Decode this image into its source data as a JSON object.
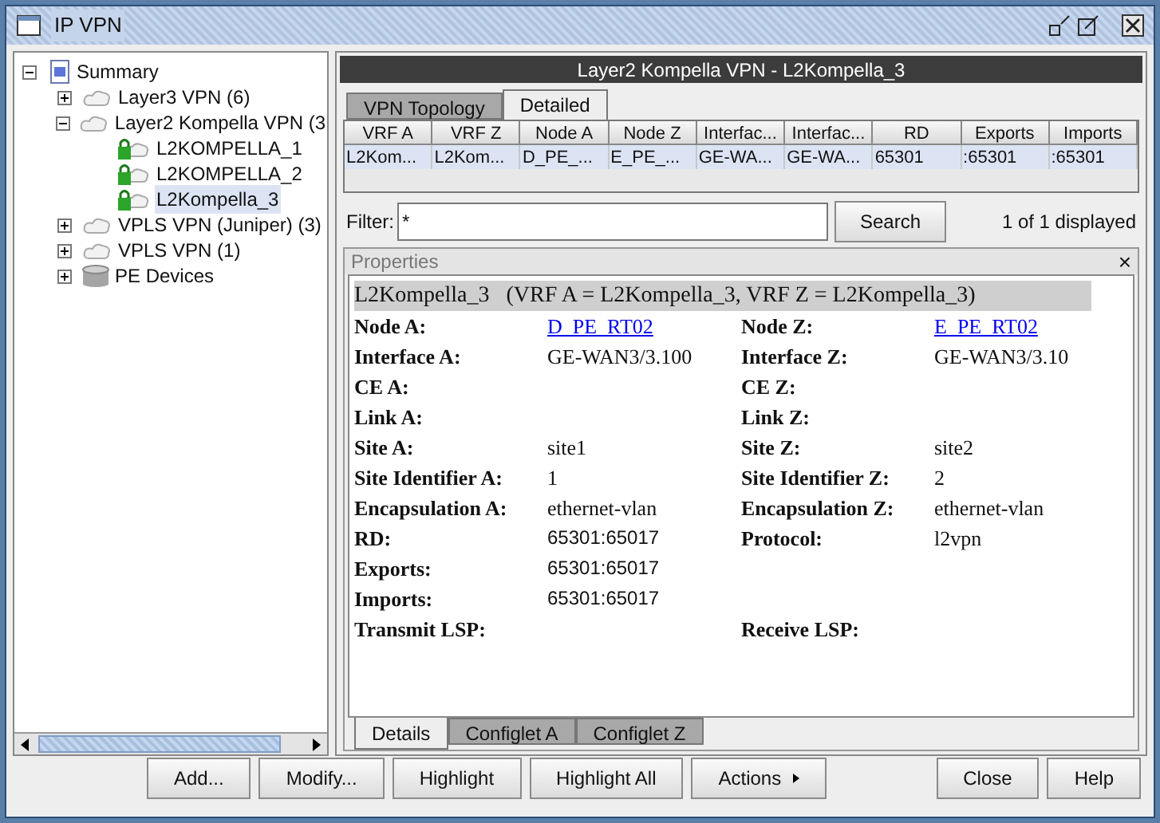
{
  "window": {
    "title": "IP VPN"
  },
  "tree": [
    {
      "label": "Summary",
      "kind": "summary",
      "expanded": true,
      "selected": false,
      "children": [
        {
          "label": "Layer3 VPN (6)",
          "kind": "vpn",
          "expanded": false,
          "selected": false
        },
        {
          "label": "Layer2 Kompella VPN (3",
          "kind": "vpn",
          "expanded": true,
          "selected": false,
          "children": [
            {
              "label": "L2KOMPELLA_1",
              "kind": "service",
              "selected": false
            },
            {
              "label": "L2KOMPELLA_2",
              "kind": "service",
              "selected": false
            },
            {
              "label": "L2Kompella_3",
              "kind": "service",
              "selected": true
            }
          ]
        },
        {
          "label": "VPLS VPN (Juniper) (3)",
          "kind": "vpn",
          "expanded": false,
          "selected": false
        },
        {
          "label": "VPLS VPN (1)",
          "kind": "vpn",
          "expanded": false,
          "selected": false
        },
        {
          "label": "PE Devices",
          "kind": "devices",
          "expanded": false,
          "selected": false
        }
      ]
    }
  ],
  "header": "Layer2 Kompella VPN - L2Kompella_3",
  "tabs": [
    {
      "label": "VPN Topology",
      "selected": false
    },
    {
      "label": "Detailed",
      "selected": true
    }
  ],
  "table": {
    "columns": [
      "VRF A",
      "VRF Z",
      "Node A",
      "Node Z",
      "Interfac...",
      "Interfac...",
      "RD",
      "Exports",
      "Imports"
    ],
    "rows": [
      {
        "selected": true,
        "cells": [
          "L2Kom...",
          "L2Kom...",
          "D_PE_...",
          "E_PE_...",
          "GE-WA...",
          "GE-WA...",
          "65301",
          ":65301",
          ":65301"
        ]
      }
    ]
  },
  "filter": {
    "label": "Filter:",
    "value": "*",
    "button": "Search",
    "count": "1 of 1 displayed"
  },
  "properties": {
    "title": "Properties",
    "close": "×",
    "heading": "L2Kompella_3   (VRF A = L2Kompella_3, VRF Z = L2Kompella_3)",
    "rows": [
      {
        "left": {
          "label": "Node A:",
          "value": "D_PE_RT02",
          "kind": "link"
        },
        "right": {
          "label": "Node Z:",
          "value": "E_PE_RT02",
          "kind": "link"
        }
      },
      {
        "left": {
          "label": "Interface A:",
          "value": "GE-WAN3/3.100",
          "kind": "text"
        },
        "right": {
          "label": "Interface Z:",
          "value": "GE-WAN3/3.10",
          "kind": "text"
        }
      },
      {
        "left": {
          "label": "CE A:"
        },
        "right": {
          "label": "CE Z:"
        }
      },
      {
        "left": {
          "label": "Link A:"
        },
        "right": {
          "label": "Link Z:"
        }
      },
      {
        "left": {
          "label": "Site A:",
          "value": "site1",
          "kind": "text"
        },
        "right": {
          "label": "Site Z:",
          "value": "site2",
          "kind": "text"
        }
      },
      {
        "left": {
          "label": "Site Identifier A:",
          "value": "1",
          "kind": "text"
        },
        "right": {
          "label": "Site Identifier Z:",
          "value": "2",
          "kind": "text"
        }
      },
      {
        "left": {
          "label": "Encapsulation A:",
          "value": "ethernet-vlan",
          "kind": "text"
        },
        "right": {
          "label": "Encapsulation Z:",
          "value": "ethernet-vlan",
          "kind": "text"
        }
      },
      {
        "left": {
          "label": "RD:",
          "value": "65301:65017",
          "kind": "code"
        },
        "right": {
          "label": "Protocol:",
          "value": "l2vpn",
          "kind": "text"
        }
      },
      {
        "left": {
          "label": "Exports:",
          "value": "65301:65017",
          "kind": "code"
        }
      },
      {
        "left": {
          "label": "Imports:",
          "value": "65301:65017",
          "kind": "code"
        }
      },
      {
        "left": {
          "label": "Transmit LSP:"
        },
        "right": {
          "label": "Receive LSP:"
        }
      }
    ],
    "tabs": [
      {
        "label": "Details",
        "selected": true
      },
      {
        "label": "Configlet A",
        "selected": false
      },
      {
        "label": "Configlet Z",
        "selected": false
      }
    ]
  },
  "buttons": {
    "left": [
      {
        "label": "Add...",
        "menu": false
      },
      {
        "label": "Modify...",
        "menu": false
      },
      {
        "label": "Highlight",
        "menu": false
      },
      {
        "label": "Highlight All",
        "menu": false
      },
      {
        "label": "Actions",
        "menu": true
      }
    ],
    "right": [
      {
        "label": "Close"
      },
      {
        "label": "Help"
      }
    ]
  }
}
